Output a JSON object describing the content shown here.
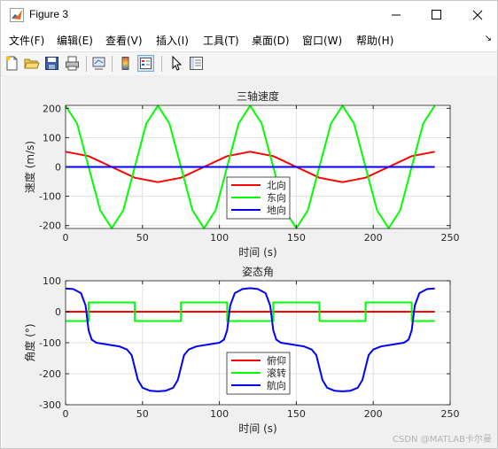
{
  "window": {
    "title": "Figure 3",
    "controls": {
      "minimize": "minimize",
      "maximize": "maximize",
      "close": "close"
    }
  },
  "menubar": {
    "items": [
      "文件(F)",
      "编辑(E)",
      "查看(V)",
      "插入(I)",
      "工具(T)",
      "桌面(D)",
      "窗口(W)",
      "帮助(H)"
    ],
    "overflow": "↘"
  },
  "toolbar": {
    "icons": [
      "new-file-icon",
      "open-folder-icon",
      "save-icon",
      "print-icon",
      "link-figure-icon",
      "colorbar-icon",
      "legend-icon",
      "pointer-icon",
      "property-inspector-icon"
    ]
  },
  "watermark": "CSDN @MATLAB卡尔曼",
  "colors": {
    "north": "#ff0000",
    "east": "#00ff00",
    "down": "#0000ff"
  },
  "chart_data": [
    {
      "type": "line",
      "title": "三轴速度",
      "xlabel": "时间 (s)",
      "ylabel": "速度 (m/s)",
      "xlim": [
        0,
        250
      ],
      "ylim": [
        -210,
        210
      ],
      "xticks": [
        0,
        50,
        100,
        150,
        200,
        250
      ],
      "xtick_labels": [
        "0",
        "50",
        "100",
        "150",
        "200",
        "250"
      ],
      "yticks": [
        200,
        100,
        0,
        -100,
        -200
      ],
      "ytick_labels": [
        "200",
        "100",
        "0",
        "-100",
        "-200"
      ],
      "grid": true,
      "legend_position": "bottom-center",
      "series": [
        {
          "name": "北向",
          "color": "#ff0000",
          "x": [
            0,
            15,
            30,
            45,
            60,
            75,
            90,
            105,
            120,
            135,
            150,
            165,
            180,
            195,
            210,
            225,
            240
          ],
          "y": [
            52,
            37,
            0,
            -37,
            -52,
            -37,
            0,
            37,
            52,
            37,
            0,
            -37,
            -52,
            -37,
            0,
            37,
            52
          ]
        },
        {
          "name": "东向",
          "color": "#00ff00",
          "x": [
            0,
            7.5,
            15,
            22.5,
            30,
            37.5,
            45,
            52.5,
            60,
            67.5,
            75,
            82.5,
            90,
            97.5,
            105,
            112.5,
            120,
            127.5,
            135,
            142.5,
            150,
            157.5,
            165,
            172.5,
            180,
            187.5,
            195,
            202.5,
            210,
            217.5,
            225,
            232.5,
            240
          ],
          "y": [
            209,
            148,
            0,
            -148,
            -209,
            -148,
            0,
            148,
            209,
            148,
            0,
            -148,
            -209,
            -148,
            0,
            148,
            209,
            148,
            0,
            -148,
            -209,
            -148,
            0,
            148,
            209,
            148,
            0,
            -148,
            -209,
            -148,
            0,
            148,
            209
          ]
        },
        {
          "name": "地向",
          "color": "#0000ff",
          "x": [
            0,
            240
          ],
          "y": [
            0,
            0
          ]
        }
      ]
    },
    {
      "type": "line",
      "title": "姿态角",
      "xlabel": "时间 (s)",
      "ylabel": "角度 (°)",
      "xlim": [
        0,
        250
      ],
      "ylim": [
        -300,
        100
      ],
      "xticks": [
        0,
        50,
        100,
        150,
        200,
        250
      ],
      "xtick_labels": [
        "0",
        "50",
        "100",
        "150",
        "200",
        "250"
      ],
      "yticks": [
        100,
        0,
        -100,
        -200,
        -300
      ],
      "ytick_labels": [
        "100",
        "0",
        "-100",
        "-200",
        "-300"
      ],
      "grid": true,
      "legend_position": "bottom-center",
      "series": [
        {
          "name": "俯仰",
          "color": "#ff0000",
          "x": [
            0,
            240
          ],
          "y": [
            0,
            0
          ]
        },
        {
          "name": "滚转",
          "color": "#00ff00",
          "x": [
            0,
            15,
            15,
            45,
            45,
            75,
            75,
            105,
            105,
            135,
            135,
            165,
            165,
            195,
            195,
            225,
            225,
            240
          ],
          "y": [
            -30,
            -30,
            30,
            30,
            -30,
            -30,
            30,
            30,
            -30,
            -30,
            30,
            30,
            -30,
            -30,
            30,
            30,
            -30,
            -30
          ]
        },
        {
          "name": "航向",
          "color": "#0000ff",
          "x": [
            0,
            5,
            10,
            13,
            15,
            17,
            20,
            25,
            35,
            40,
            43,
            45,
            47,
            50,
            55,
            60,
            65,
            70,
            73,
            75,
            77,
            80,
            85,
            95,
            100,
            103,
            105,
            107,
            110,
            115,
            120,
            125,
            130,
            133,
            135,
            137,
            140,
            145,
            155,
            160,
            163,
            165,
            167,
            170,
            175,
            180,
            185,
            190,
            193,
            195,
            197,
            200,
            205,
            215,
            220,
            223,
            225,
            227,
            230,
            235,
            240
          ],
          "y": [
            75,
            73,
            60,
            20,
            -60,
            -90,
            -100,
            -104,
            -112,
            -122,
            -140,
            -180,
            -220,
            -245,
            -255,
            -257,
            -255,
            -245,
            -220,
            -180,
            -140,
            -122,
            -112,
            -104,
            -100,
            -90,
            -60,
            20,
            60,
            73,
            76,
            73,
            60,
            20,
            -60,
            -90,
            -100,
            -104,
            -112,
            -122,
            -140,
            -180,
            -220,
            -245,
            -255,
            -257,
            -255,
            -245,
            -220,
            -180,
            -140,
            -122,
            -112,
            -104,
            -100,
            -90,
            -60,
            20,
            60,
            73,
            75
          ]
        }
      ]
    }
  ]
}
